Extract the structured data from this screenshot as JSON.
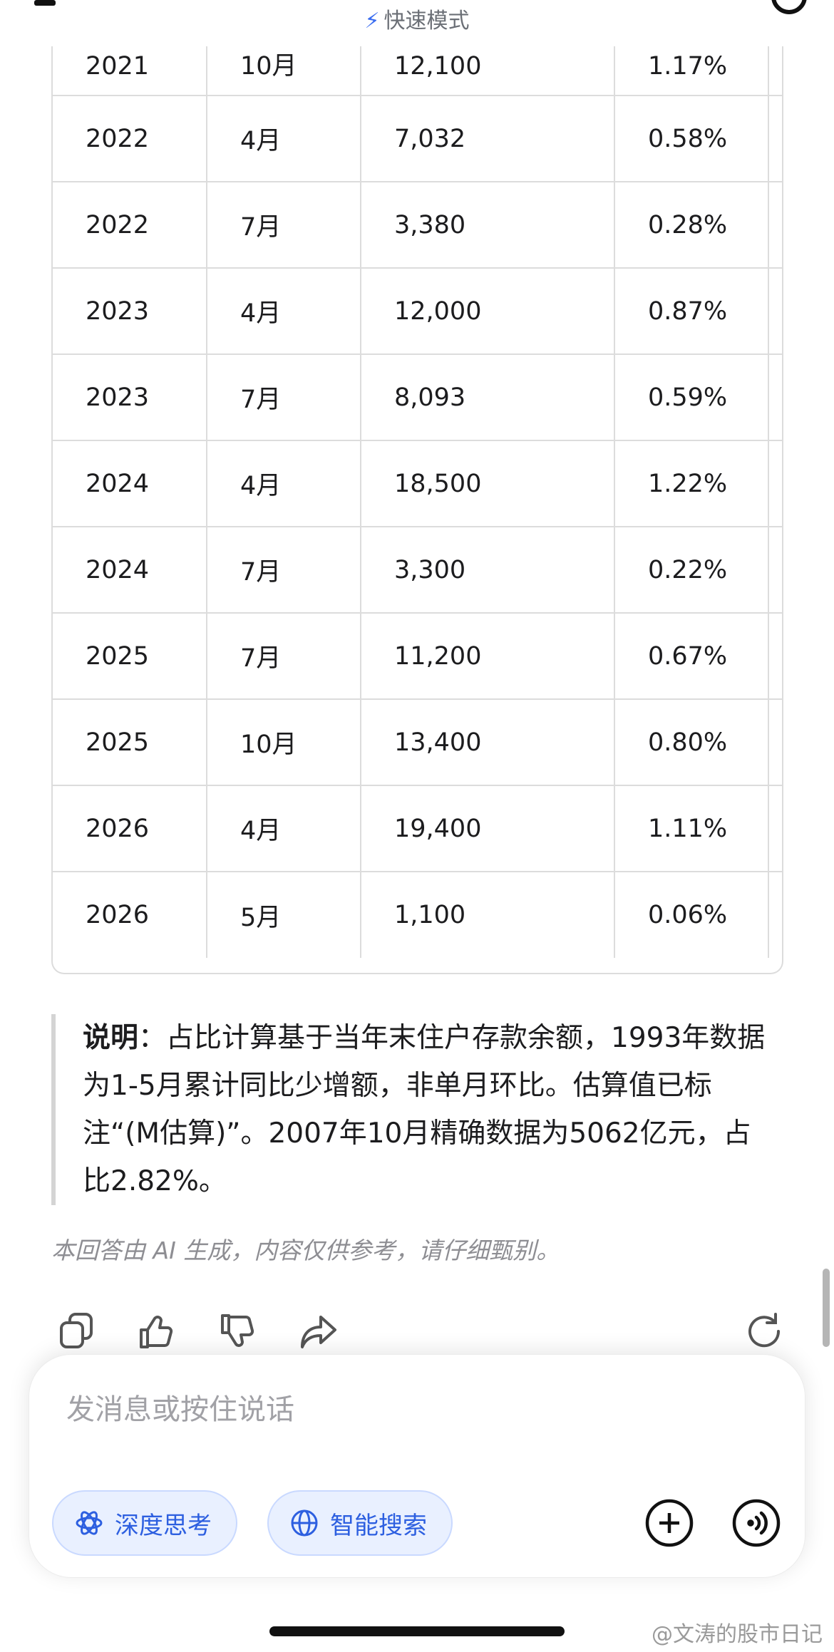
{
  "header": {
    "mode_label": "快速模式"
  },
  "table": {
    "partial_row": [
      "2021",
      "10月",
      "12,100",
      "1.17%"
    ],
    "rows": [
      [
        "2022",
        "4月",
        "7,032",
        "0.58%"
      ],
      [
        "2022",
        "7月",
        "3,380",
        "0.28%"
      ],
      [
        "2023",
        "4月",
        "12,000",
        "0.87%"
      ],
      [
        "2023",
        "7月",
        "8,093",
        "0.59%"
      ],
      [
        "2024",
        "4月",
        "18,500",
        "1.22%"
      ],
      [
        "2024",
        "7月",
        "3,300",
        "0.22%"
      ],
      [
        "2025",
        "7月",
        "11,200",
        "0.67%"
      ],
      [
        "2025",
        "10月",
        "13,400",
        "0.80%"
      ],
      [
        "2026",
        "4月",
        "19,400",
        "1.11%"
      ],
      [
        "2026",
        "5月",
        "1,100",
        "0.06%"
      ]
    ]
  },
  "note": {
    "label": "说明",
    "text": "：占比计算基于当年末住户存款余额，1993年数据为1-5月累计同比少增额，非单月环比。估算值已标注“(M估算)”。2007年10月精确数据为5062亿元，占比2.82%。"
  },
  "disclaimer": "本回答由 AI 生成，内容仅供参考，请仔细甄别。",
  "input": {
    "placeholder": "发消息或按住说话",
    "chip_deep_think": "深度思考",
    "chip_smart_search": "智能搜索"
  },
  "watermark": "@文涛的股市日记",
  "icons": [
    "menu-icon",
    "lightning-icon",
    "copy-icon",
    "thumbs-up-icon",
    "thumbs-down-icon",
    "share-icon",
    "refresh-icon",
    "atom-icon",
    "globe-icon",
    "plus-icon",
    "voice-icon"
  ]
}
